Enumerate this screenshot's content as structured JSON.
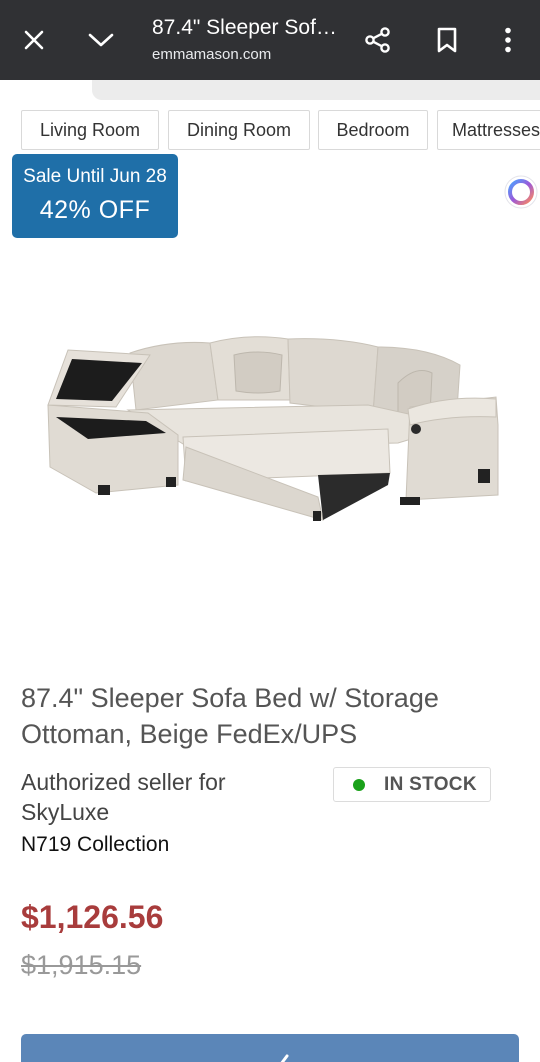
{
  "browser": {
    "title": "87.4\" Sleeper Sofa Bed w/ Storage Ottoman, Beige FedEx/UPS",
    "url": "emmamason.com",
    "icons": {
      "close": "close-icon",
      "collapse": "chevron-down-icon",
      "share": "share-icon",
      "bookmark": "bookmark-icon",
      "menu": "more-vert-icon"
    }
  },
  "categories": [
    "Living Room",
    "Dining Room",
    "Bedroom",
    "Mattresses"
  ],
  "sale_badge": {
    "line1": "Sale Until Jun 28",
    "line2": "42% OFF"
  },
  "product": {
    "image_alt": "sectional-sleeper-sofa-image",
    "title": "87.4\" Sleeper Sofa Bed w/ Storage Ottoman, Beige FedEx/UPS",
    "seller": "Authorized seller for SkyLuxe",
    "stock_status": "IN STOCK",
    "collection": "N719 Collection",
    "price": "$1,126.56",
    "original_price": "$1,915.15"
  },
  "colors": {
    "topbar": "#303134",
    "badge": "#1f6fa8",
    "price": "#a83c3c",
    "in_stock": "#1aa11a",
    "cta": "#5b86b8"
  }
}
